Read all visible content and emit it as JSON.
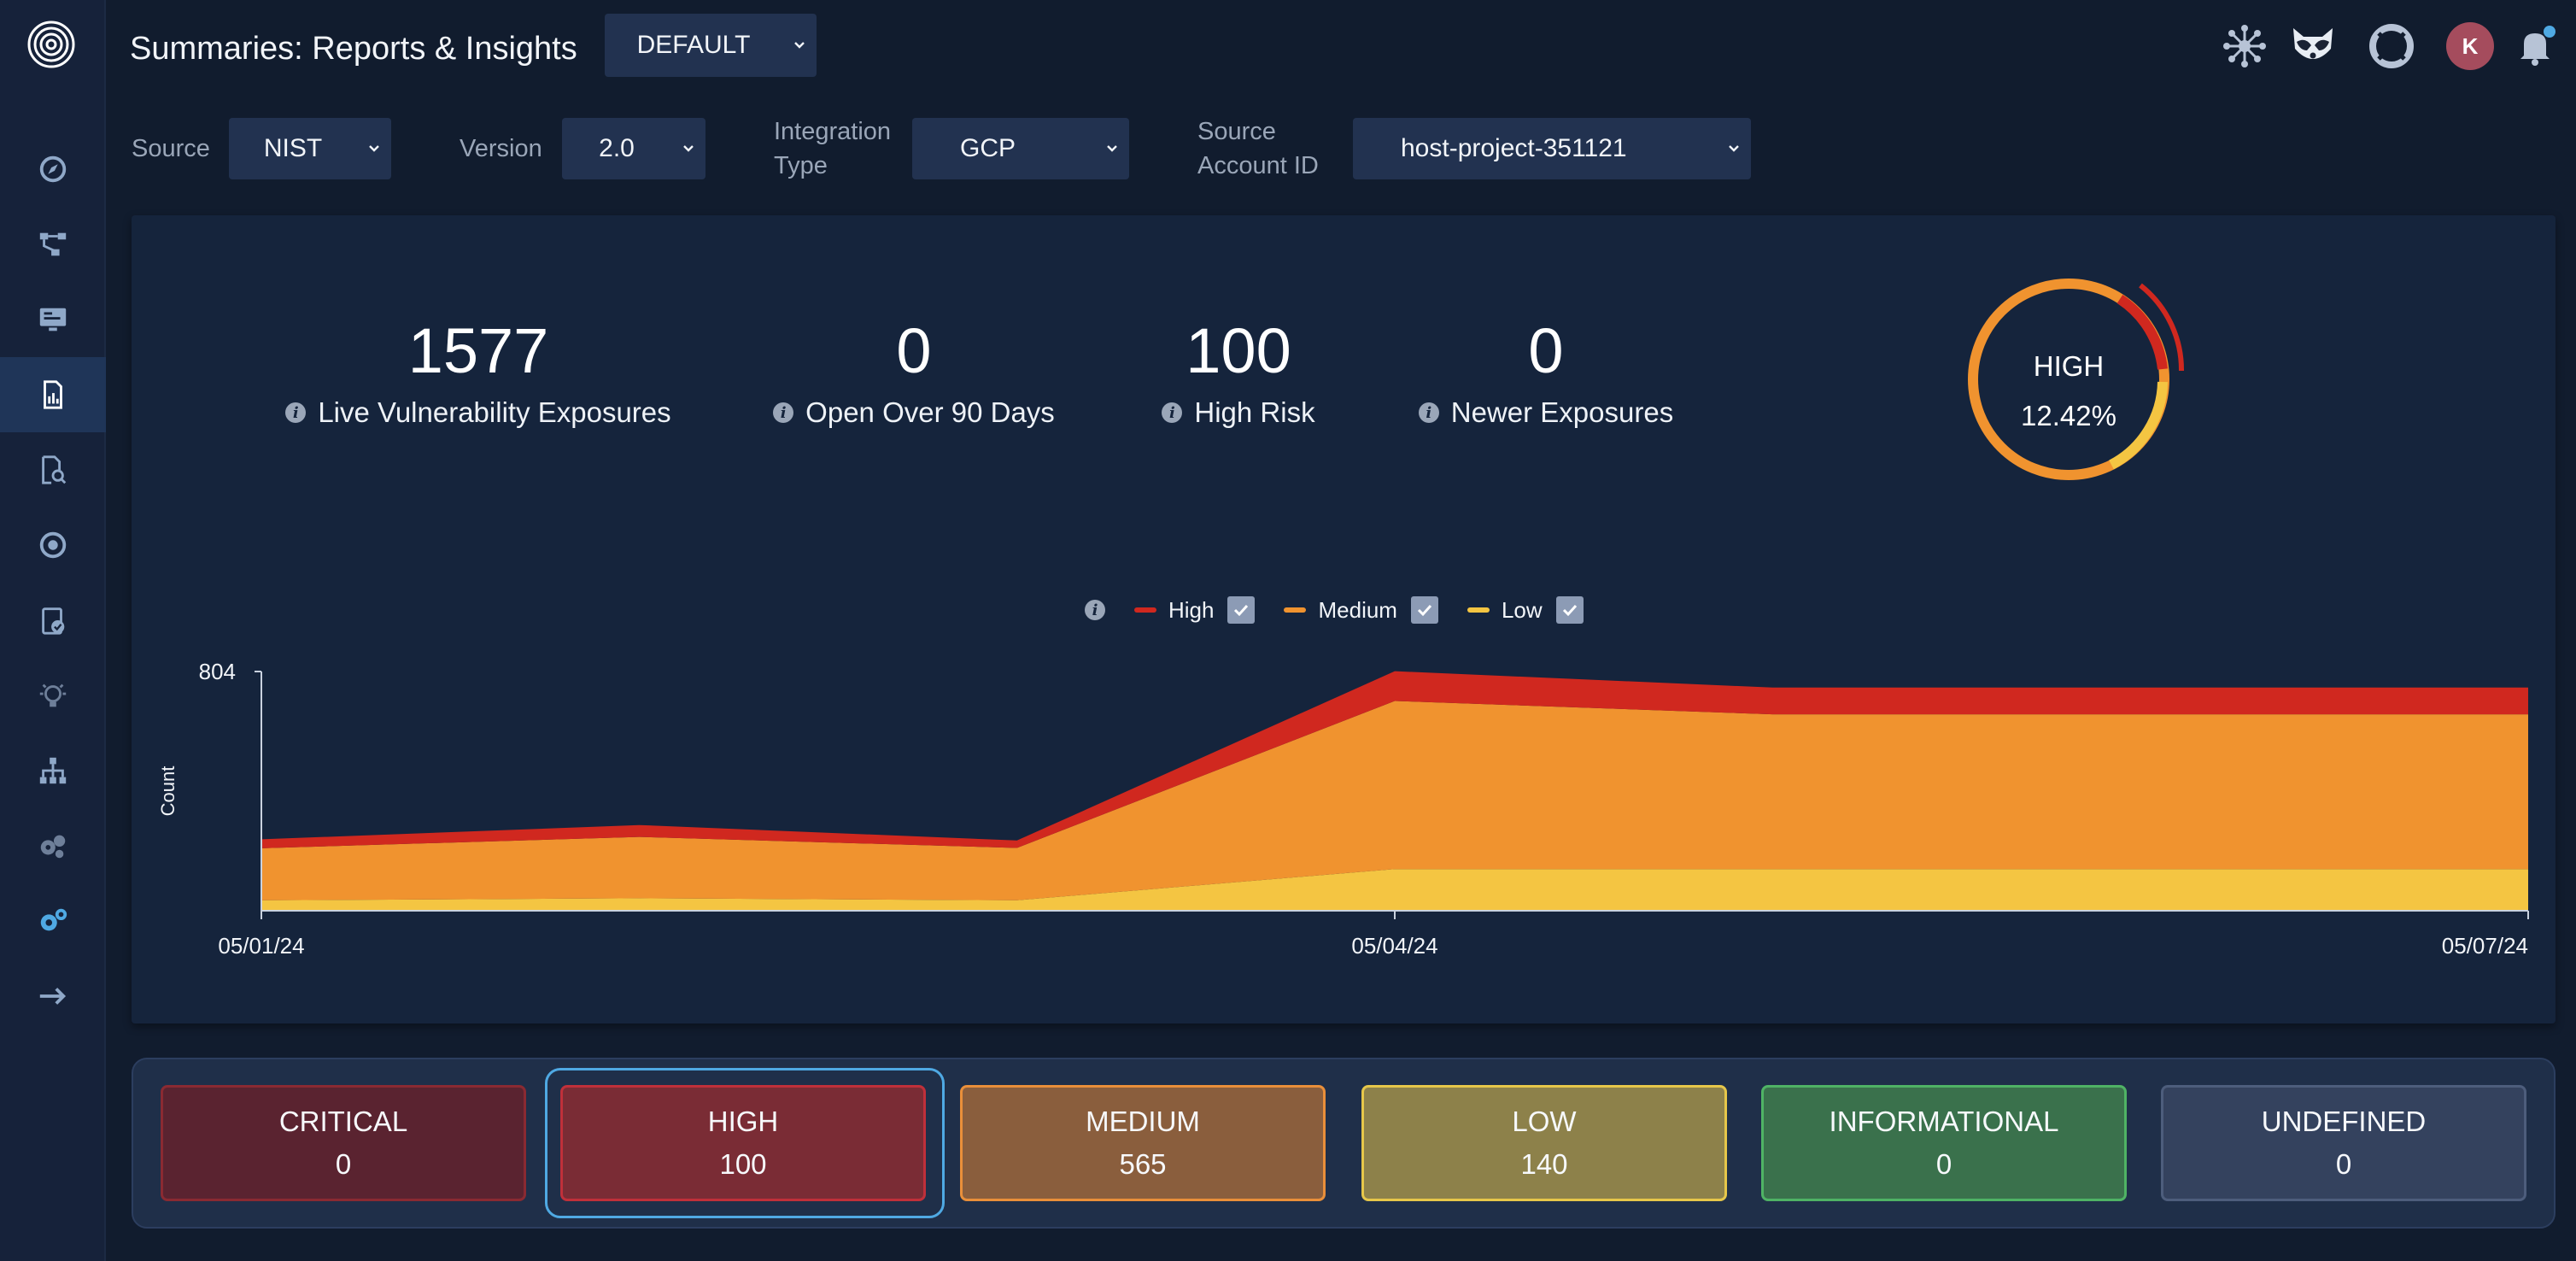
{
  "header": {
    "title": "Summaries: Reports & Insights",
    "preset": "DEFAULT",
    "avatar_initial": "K"
  },
  "filters": {
    "source_label": "Source",
    "source_value": "NIST",
    "version_label": "Version",
    "version_value": "2.0",
    "integration_label_1": "Integration",
    "integration_label_2": "Type",
    "integration_value": "GCP",
    "account_label_1": "Source",
    "account_label_2": "Account ID",
    "account_value": "host-project-351121"
  },
  "stats": [
    {
      "value": "1577",
      "label": "Live Vulnerability Exposures"
    },
    {
      "value": "0",
      "label": "Open Over 90 Days"
    },
    {
      "value": "100",
      "label": "High Risk"
    },
    {
      "value": "0",
      "label": "Newer Exposures"
    }
  ],
  "donut": {
    "label": "HIGH",
    "percent_text": "12.42%"
  },
  "legend": {
    "high": "High",
    "medium": "Medium",
    "low": "Low"
  },
  "chart_data": {
    "type": "area",
    "stacked": true,
    "ylabel": "Count",
    "ymax_label": "804",
    "ylim": [
      0,
      804
    ],
    "x_tick_labels": [
      "05/01/24",
      "05/04/24",
      "05/07/24"
    ],
    "x": [
      "05/01/24",
      "05/02/24",
      "05/03/24",
      "05/04/24",
      "05/05/24",
      "05/06/24",
      "05/07/24"
    ],
    "series": [
      {
        "name": "Low",
        "color": "#f4c542",
        "values": [
          35,
          42,
          35,
          140,
          140,
          140,
          140
        ]
      },
      {
        "name": "Medium",
        "color": "#f0932f",
        "values": [
          175,
          206,
          176,
          565,
          520,
          520,
          520
        ]
      },
      {
        "name": "High",
        "color": "#d0281f",
        "values": [
          30,
          40,
          25,
          100,
          90,
          90,
          90
        ]
      }
    ]
  },
  "severity": [
    {
      "label": "CRITICAL",
      "value": "0",
      "bg": "#5a2330",
      "border": "#8a2a32"
    },
    {
      "label": "HIGH",
      "value": "100",
      "bg": "#7a2c35",
      "border": "#c0303a"
    },
    {
      "label": "MEDIUM",
      "value": "565",
      "bg": "#8a5e3d",
      "border": "#e98f3a"
    },
    {
      "label": "LOW",
      "value": "140",
      "bg": "#8d814a",
      "border": "#e6c74a"
    },
    {
      "label": "INFORMATIONAL",
      "value": "0",
      "bg": "#3a714c",
      "border": "#4fb365"
    },
    {
      "label": "UNDEFINED",
      "value": "0",
      "bg": "#34425e",
      "border": "#4d5d7c"
    }
  ],
  "colors": {
    "accent": "#4fa9e3",
    "high": "#d0281f",
    "medium": "#f0932f",
    "low": "#f4c542"
  }
}
